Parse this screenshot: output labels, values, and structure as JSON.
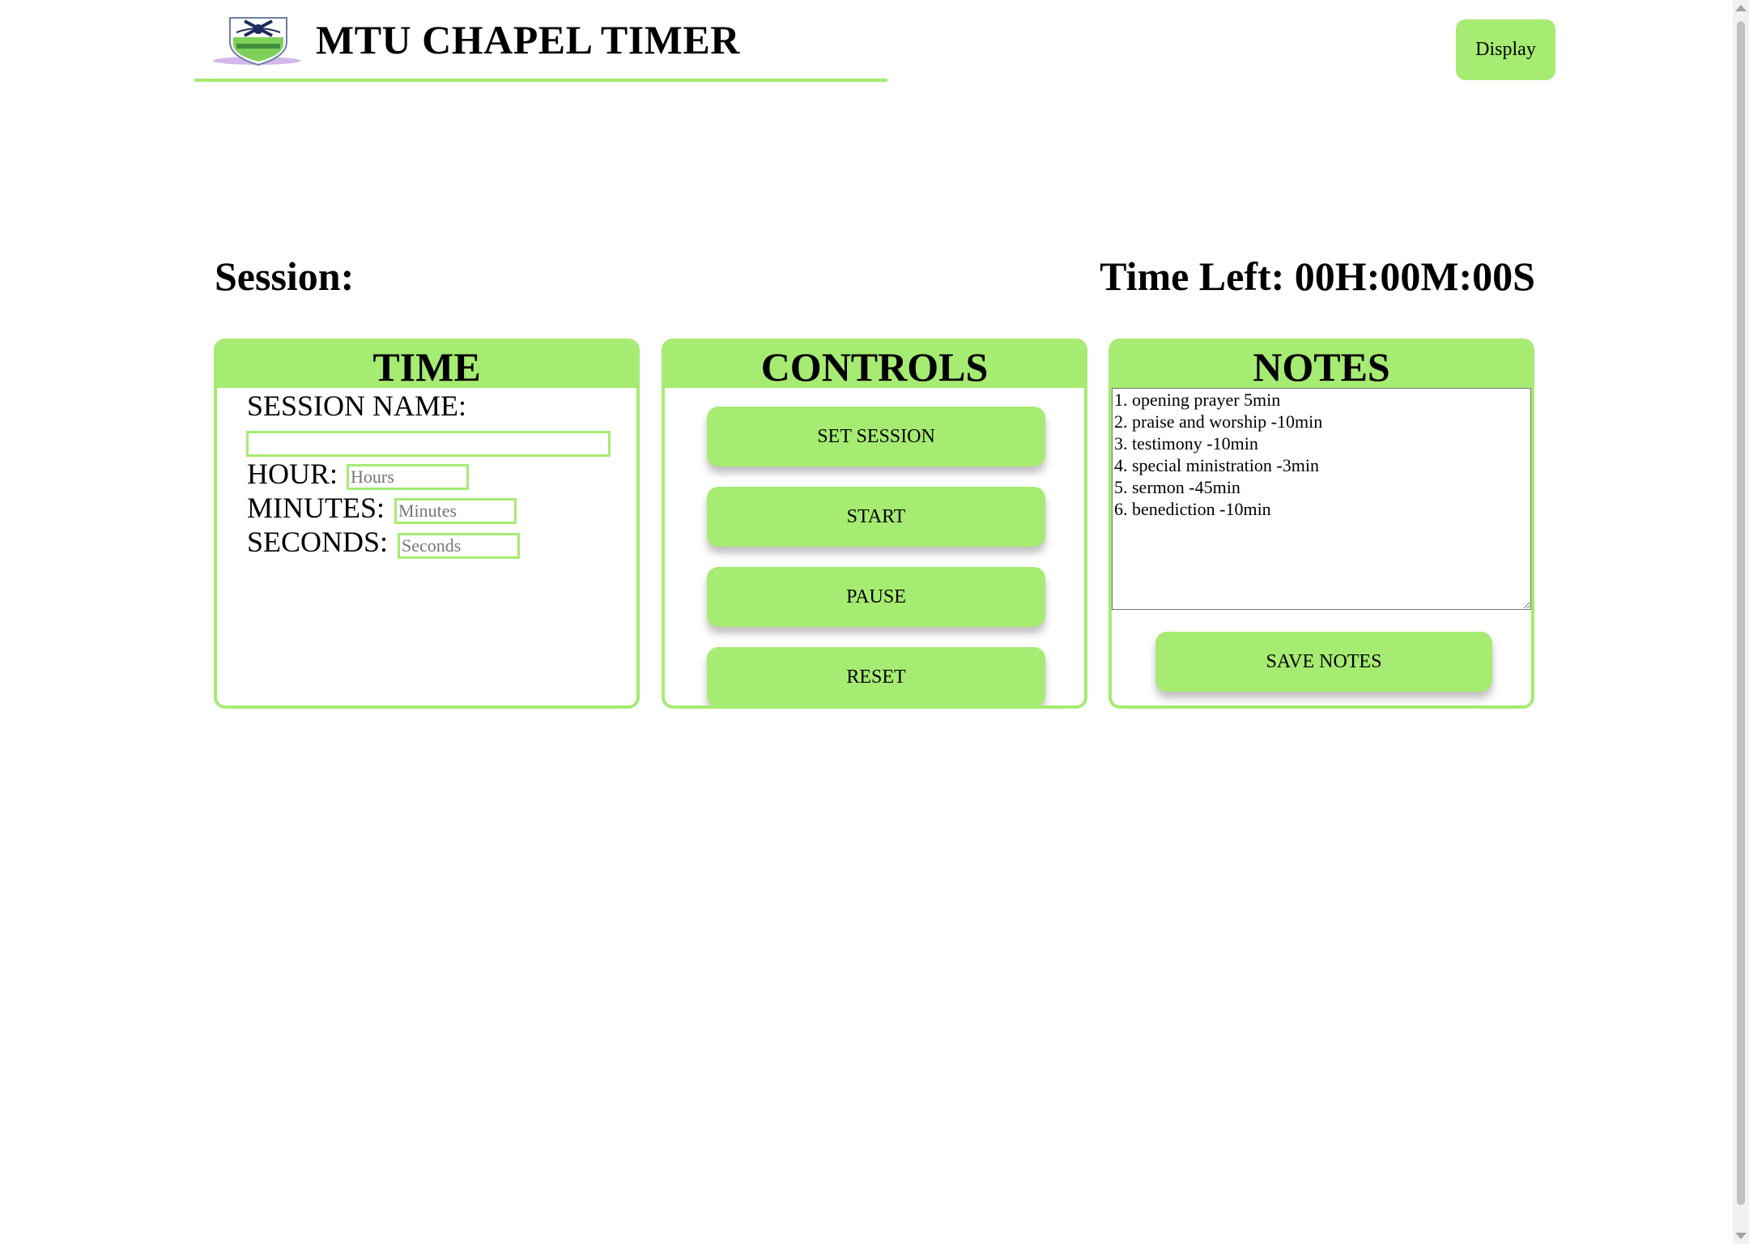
{
  "header": {
    "title": "MTU CHAPEL TIMER",
    "display_label": "Display"
  },
  "status": {
    "session_label": "Session:",
    "time_left": "Time Left: 00H:00M:00S"
  },
  "time_panel": {
    "title": "TIME",
    "session_name_label": "SESSION NAME:",
    "session_name_value": "",
    "hour_label": "HOUR:",
    "hour_placeholder": "Hours",
    "minutes_label": "MINUTES:",
    "minutes_placeholder": "Minutes",
    "seconds_label": "SECONDS:",
    "seconds_placeholder": "Seconds"
  },
  "controls_panel": {
    "title": "CONTROLS",
    "set_session_label": "SET SESSION",
    "start_label": "START",
    "pause_label": "PAUSE",
    "reset_label": "RESET"
  },
  "notes_panel": {
    "title": "NOTES",
    "notes_text": "1. opening prayer 5min\n2. praise and worship -10min\n3. testimony -10min\n4. special ministration -3min\n5. sermon -45min\n6. benediction -10min",
    "save_label": "SAVE NOTES"
  },
  "colors": {
    "accent": "#a6eb72",
    "text": "#000000",
    "background": "#ffffff"
  },
  "icons": {
    "logo": "mtu-crest-logo-icon"
  }
}
